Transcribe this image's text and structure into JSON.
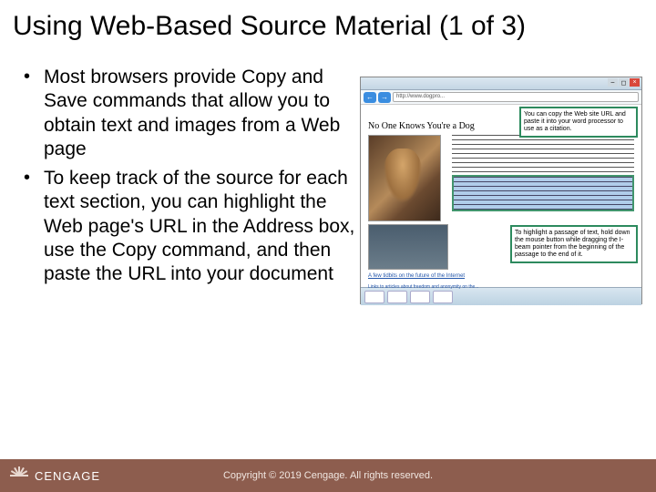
{
  "title": "Using Web-Based Source Material (1 of 3)",
  "bullets": [
    "Most browsers provide Copy and Save commands that allow you to obtain text and images from a Web page",
    "To keep track of the source for each text section, you can highlight the Web page's URL in the Address box, use the Copy command, and then paste the URL into your document"
  ],
  "browser": {
    "addr": "http://www.dogpro...",
    "callout1": "You can copy the Web site URL and paste it into your word processor to use as a citation.",
    "callout2": "To highlight a passage of text, hold down the mouse button while dragging the I-beam pointer from the beginning of the passage to the end of it.",
    "pageTitle": "No One Knows You're a Dog",
    "caption": "A few tidbits on the future of the Internet",
    "links": "Links to articles about freedom and anonymity on the..."
  },
  "footer": {
    "brand": "CENGAGE",
    "copyright": "Copyright © 2019 Cengage. All rights reserved."
  }
}
